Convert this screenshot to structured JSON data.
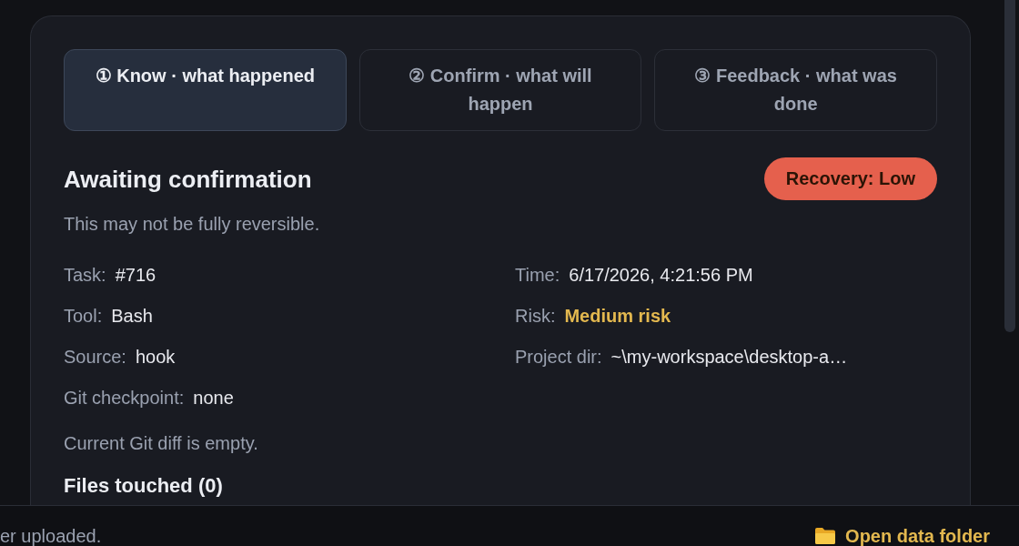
{
  "tabs": [
    {
      "label": "① Know · what happened",
      "selected": true
    },
    {
      "label": "② Confirm · what will happen",
      "selected": false
    },
    {
      "label": "③ Feedback · what was done",
      "selected": false
    }
  ],
  "header": {
    "title": "Awaiting confirmation",
    "badge": "Recovery: Low"
  },
  "subtitle": "This may not be fully reversible.",
  "fields": [
    {
      "label": "Task:",
      "value": "#716",
      "kind": "plain"
    },
    {
      "label": "Time:",
      "value": "6/17/2026, 4:21:56 PM",
      "kind": "plain"
    },
    {
      "label": "Tool:",
      "value": "Bash",
      "kind": "plain"
    },
    {
      "label": "Risk:",
      "value": "Medium risk",
      "kind": "risk"
    },
    {
      "label": "Source:",
      "value": "hook",
      "kind": "plain"
    },
    {
      "label": "Project dir:",
      "value": "~\\my-workspace\\desktop-a…",
      "kind": "plain"
    },
    {
      "label": "Git checkpoint:",
      "value": "none",
      "kind": "plain"
    }
  ],
  "diff_note": "Current Git diff is empty.",
  "files_heading": "Files touched (0)",
  "footer": {
    "message": "er uploaded.",
    "open_folder_button": "Open data folder"
  }
}
